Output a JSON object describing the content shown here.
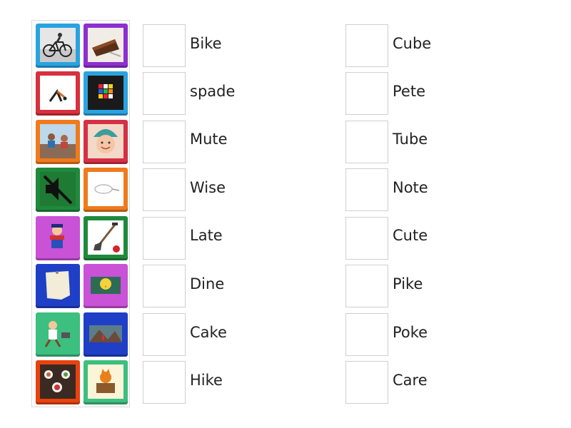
{
  "tiles": [
    {
      "name": "bicycle-rider-image",
      "frame": "#29a3e0"
    },
    {
      "name": "chocolate-cake-image",
      "frame": "#8e2fcf"
    },
    {
      "name": "yoga-pose-image",
      "frame": "#d8303c"
    },
    {
      "name": "rubiks-cube-image",
      "frame": "#2aa3e0"
    },
    {
      "name": "family-on-sofa-image",
      "frame": "#f07a1c"
    },
    {
      "name": "baby-in-hat-image",
      "frame": "#d63045"
    },
    {
      "name": "mute-speaker-image",
      "frame": "#1f8a3c"
    },
    {
      "name": "earphone-cable-image",
      "frame": "#f07a1c"
    },
    {
      "name": "cartoon-plumber-image",
      "frame": "#c952d6"
    },
    {
      "name": "garden-spade-image",
      "frame": "#1f8a3c"
    },
    {
      "name": "paper-note-image",
      "frame": "#1f3fc6"
    },
    {
      "name": "yellow-chick-chalkboard-image",
      "frame": "#c952d6"
    },
    {
      "name": "running-man-cartoon-image",
      "frame": "#3cbf7f"
    },
    {
      "name": "mountain-hikers-image",
      "frame": "#1f3fc6"
    },
    {
      "name": "dinner-table-image",
      "frame": "#e8420f"
    },
    {
      "name": "cartoon-fox-stump-image",
      "frame": "#3cbf7f"
    }
  ],
  "words_left": [
    "Bike",
    "spade",
    "Mute",
    "Wise",
    "Late",
    "Dine",
    "Cake",
    "Hike"
  ],
  "words_right": [
    "Cube",
    "Pete",
    "Tube",
    "Note",
    "Cute",
    "Pike",
    "Poke",
    "Care"
  ]
}
